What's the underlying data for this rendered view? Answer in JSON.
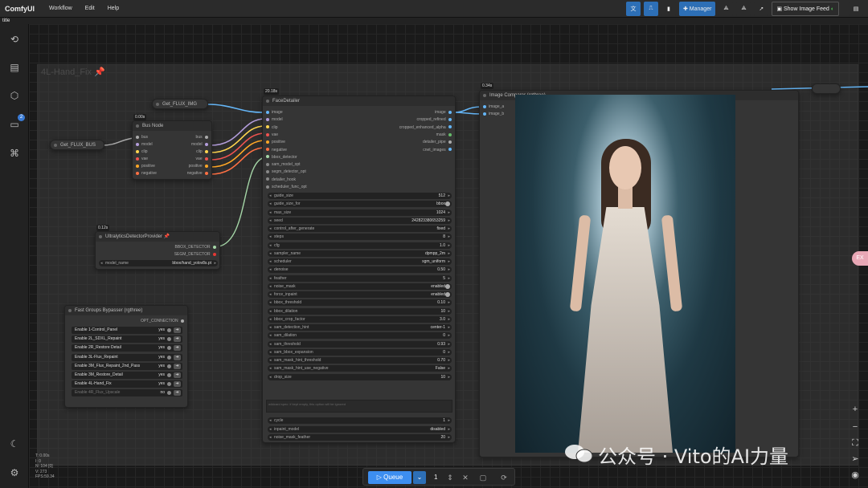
{
  "app": {
    "brand": "ComfyUI",
    "menu": [
      "Workflow",
      "Edit",
      "Help"
    ],
    "tab": "title"
  },
  "toolbar": {
    "manager_label": "Manager",
    "image_feed_label": "Show Image Feed"
  },
  "sidebar": {
    "queue_badge": "2"
  },
  "group": {
    "title": "4L-Hand_Fix"
  },
  "nodes": {
    "get_img": {
      "title": "Get_FLUX_IMG"
    },
    "get_bus": {
      "title": "Get_FLUX_BUS"
    },
    "bus_node": {
      "title": "Bus Node",
      "timing": "0.00s",
      "inputs": [
        "bus",
        "model",
        "clip",
        "vae",
        "positive",
        "negative"
      ],
      "outputs": [
        "bus",
        "model",
        "clip",
        "vae",
        "positive",
        "negative"
      ]
    },
    "detector": {
      "title": "UltralyticsDetectorProvider",
      "timing": "0.12s",
      "outputs": [
        "BBOX_DETECTOR",
        "SEGM_DETECTOR"
      ],
      "widget": {
        "label": "model_name",
        "value": "bbox/hand_yolov8s.pt"
      }
    },
    "face_detailer": {
      "title": "FaceDetailer",
      "timing": "20.18s",
      "inputs": [
        "image",
        "model",
        "clip",
        "vae",
        "positive",
        "negative",
        "bbox_detector",
        "sam_model_opt",
        "segm_detector_opt",
        "detailer_hook",
        "scheduler_func_opt"
      ],
      "outputs": [
        "image",
        "cropped_refined",
        "cropped_enhanced_alpha",
        "mask",
        "detailer_pipe",
        "cnet_images"
      ],
      "widgets": [
        {
          "label": "guide_size",
          "value": "512"
        },
        {
          "label": "guide_size_for",
          "value": "bbox"
        },
        {
          "label": "max_size",
          "value": "1024"
        },
        {
          "label": "seed",
          "value": "242823380653259"
        },
        {
          "label": "control_after_generate",
          "value": "fixed"
        },
        {
          "label": "steps",
          "value": "8"
        },
        {
          "label": "cfg",
          "value": "1.0"
        },
        {
          "label": "sampler_name",
          "value": "dpmpp_2m"
        },
        {
          "label": "scheduler",
          "value": "sgm_uniform"
        },
        {
          "label": "denoise",
          "value": "0.50"
        },
        {
          "label": "feather",
          "value": "5"
        },
        {
          "label": "noise_mask",
          "value": "enabled"
        },
        {
          "label": "force_inpaint",
          "value": "enabled"
        },
        {
          "label": "bbox_threshold",
          "value": "0.10"
        },
        {
          "label": "bbox_dilation",
          "value": "10"
        },
        {
          "label": "bbox_crop_factor",
          "value": "3.0"
        },
        {
          "label": "sam_detection_hint",
          "value": "center-1"
        },
        {
          "label": "sam_dilation",
          "value": "0"
        },
        {
          "label": "sam_threshold",
          "value": "0.93"
        },
        {
          "label": "sam_bbox_expansion",
          "value": "0"
        },
        {
          "label": "sam_mask_hint_threshold",
          "value": "0.70"
        },
        {
          "label": "sam_mask_hint_use_negative",
          "value": "False"
        },
        {
          "label": "drop_size",
          "value": "10"
        }
      ],
      "widgets2": [
        {
          "label": "cycle",
          "value": "1"
        },
        {
          "label": "inpaint_model",
          "value": "disabled"
        },
        {
          "label": "noise_mask_feather",
          "value": "20"
        }
      ]
    },
    "image_comparer": {
      "title": "Image Comparer (rgthree)",
      "timing": "0.34s",
      "inputs": [
        "image_a",
        "image_b"
      ]
    },
    "bypasser": {
      "title": "Fast Groups Bypasser (rgthree)",
      "output": "OPT_CONNECTION",
      "rows": [
        {
          "label": "Enable 1-Control_Panel",
          "value": "yes"
        },
        {
          "label": "Enable 2L_SDXL_Repaint",
          "value": "yes"
        },
        {
          "label": "Enable 2R_Restore Detail",
          "value": "yes"
        },
        {
          "label": "Enable 3L-Flux_Repaint",
          "value": "yes"
        },
        {
          "label": "Enable 3M_Flux_Repaint_2nd_Pass",
          "value": "yes"
        },
        {
          "label": "Enable 3M_Restore_Detail",
          "value": "yes"
        },
        {
          "label": "Enable 4L-Hand_Fix",
          "value": "yes"
        },
        {
          "label": "Enable 4R_Flux_Upscale",
          "value": "no"
        }
      ]
    }
  },
  "queue": {
    "label": "Queue",
    "count": "1"
  },
  "stats": [
    "T: 0.00s",
    "I: 0",
    "N: 104 [0]",
    "V: 273",
    "FPS:59.34"
  ],
  "pink_tab": "EX",
  "watermark": "公众号 · Vito的AI力量",
  "colors": {
    "accent": "#2d6fb6",
    "queue": "#3d8ef0",
    "node_bg": "#353535"
  }
}
